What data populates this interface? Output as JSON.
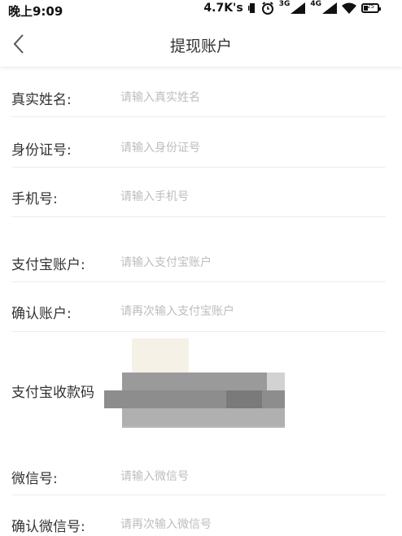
{
  "status_bar": {
    "time": "晚上9:09",
    "speed": "4.7K's",
    "net_3g": "3G",
    "net_4g": "4G",
    "battery": "25"
  },
  "header": {
    "title": "提现账户",
    "back_icon": "chevron-left-icon"
  },
  "form": {
    "real_name": {
      "label": "真实姓名:",
      "placeholder": "请输入真实姓名",
      "value": ""
    },
    "id_number": {
      "label": "身份证号:",
      "placeholder": "请输入身份证号",
      "value": ""
    },
    "phone": {
      "label": "手机号:",
      "placeholder": "请输入手机号",
      "value": ""
    },
    "alipay_account": {
      "label": "支付宝账户:",
      "placeholder": "请输入支付宝账户",
      "value": ""
    },
    "confirm_account": {
      "label": "确认账户:",
      "placeholder": "请再次输入支付宝账户",
      "value": ""
    },
    "alipay_qr": {
      "label": "支付宝收款码"
    },
    "wechat_id": {
      "label": "微信号:",
      "placeholder": "请输入微信号",
      "value": ""
    },
    "confirm_wechat": {
      "label": "确认微信号:",
      "placeholder": "请再次输入微信号",
      "value": ""
    }
  },
  "colors": {
    "text": "#333333",
    "placeholder": "#bdbdbd",
    "divider": "#ececec",
    "background": "#ffffff"
  }
}
